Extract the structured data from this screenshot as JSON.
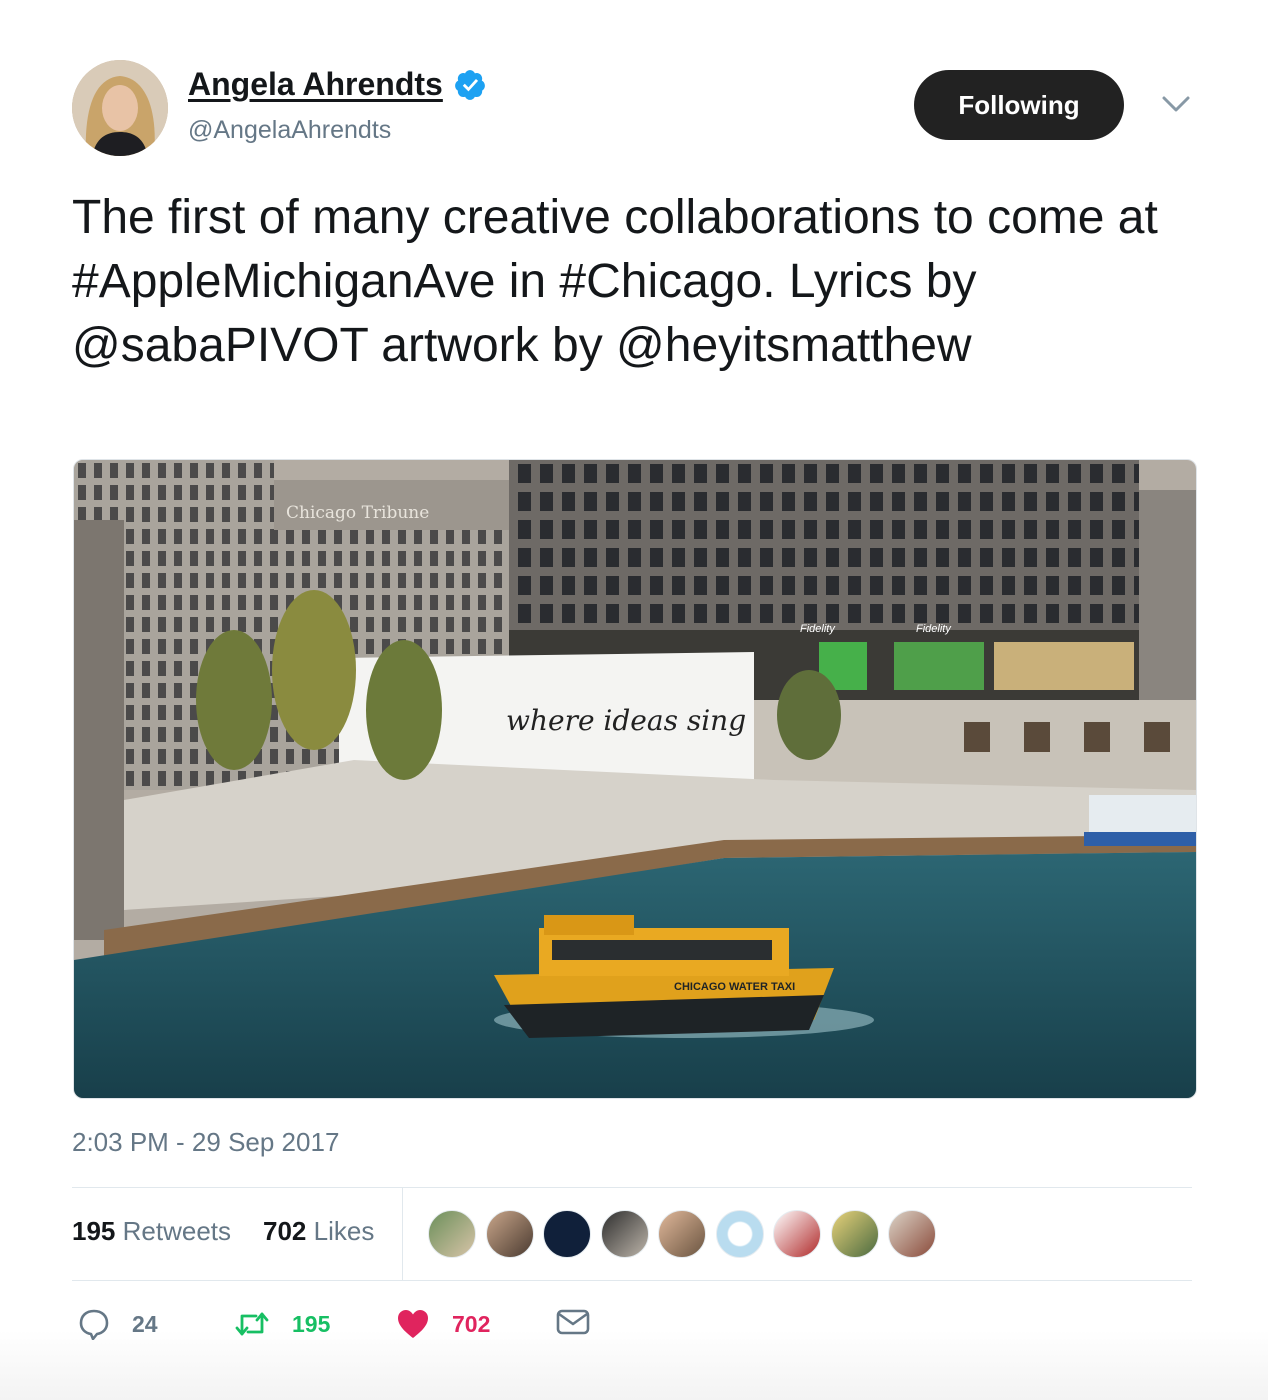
{
  "user": {
    "name": "Angela Ahrendts",
    "handle": "@AngelaAhrendts",
    "verified": true,
    "follow_button_label": "Following"
  },
  "tweet": {
    "text": "The first of many creative collaborations to come at #AppleMichiganAve in #Chicago. Lyrics by @sabaPIVOT artwork by @heyitsmatthew",
    "photo_sign_text": "where ideas sing",
    "photo_labels": [
      "Chicago Tribune",
      "Fidelity",
      "Fidelity",
      "CHICAGO WATER TAXI"
    ],
    "timestamp": "2:03 PM - 29 Sep 2017"
  },
  "stats": {
    "retweets_count": "195",
    "retweets_label": "Retweets",
    "likes_count": "702",
    "likes_label": "Likes",
    "likers": [
      "liker-1",
      "liker-2",
      "liker-3",
      "liker-4",
      "liker-5",
      "liker-6",
      "liker-7",
      "liker-8",
      "liker-9"
    ]
  },
  "actions": {
    "reply_count": "24",
    "retweet_count": "195",
    "like_count": "702"
  },
  "colors": {
    "retweet_green": "#17bf63",
    "like_red": "#e0245e",
    "verified_blue": "#1da1f2",
    "secondary_text": "#657786"
  }
}
